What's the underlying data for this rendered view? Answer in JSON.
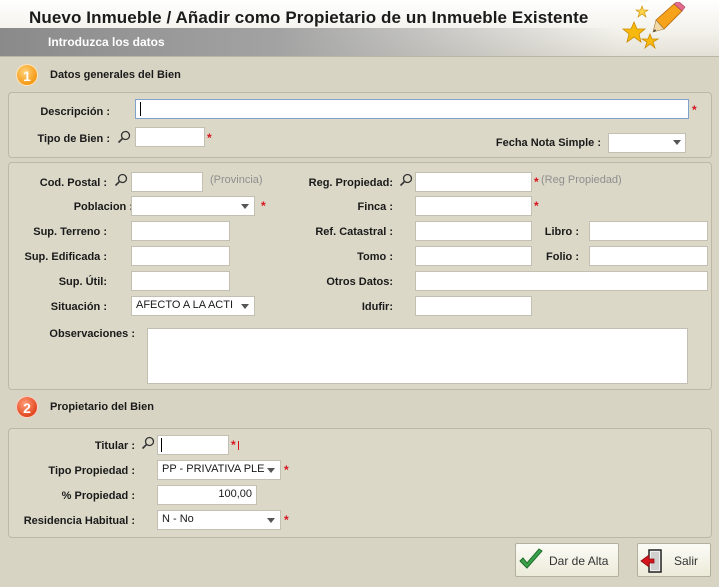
{
  "header": {
    "title": "Nuevo Inmueble / Añadir como Propietario de un Inmueble Existente",
    "subtitle": "Introduzca los datos",
    "icon": "stars-pencil-icon"
  },
  "section1": {
    "number": "1",
    "title": "Datos generales del Bien"
  },
  "section2": {
    "number": "2",
    "title": "Propietario del Bien"
  },
  "general": {
    "descripcion_label": "Descripción :",
    "descripcion_value": "",
    "tipo_bien_label": "Tipo de Bien :",
    "tipo_bien_value": "",
    "fecha_nota_label": "Fecha Nota Simple :",
    "fecha_nota_value": ""
  },
  "location": {
    "cod_postal_label": "Cod. Postal :",
    "cod_postal_value": "",
    "provincia_hint": "(Provincia)",
    "poblacion_label": "Poblacion :",
    "poblacion_value": "",
    "sup_terreno_label": "Sup. Terreno :",
    "sup_edificada_label": "Sup. Edificada :",
    "sup_util_label": "Sup. Útil:",
    "situacion_label": "Situación :",
    "situacion_value": "AFECTO A LA ACTI",
    "observaciones_label": "Observaciones :",
    "reg_propiedad_label": "Reg. Propiedad:",
    "reg_propiedad_hint": "(Reg Propiedad)",
    "finca_label": "Finca :",
    "ref_catastral_label": "Ref. Catastral :",
    "tomo_label": "Tomo :",
    "otros_datos_label": "Otros Datos:",
    "idufir_label": "Idufir:",
    "libro_label": "Libro :",
    "folio_label": "Folio :"
  },
  "owner": {
    "titular_label": "Titular :",
    "titular_value": "",
    "tipo_propiedad_label": "Tipo Propiedad :",
    "tipo_propiedad_value": "PP - PRIVATIVA PLE",
    "pct_propiedad_label": "% Propiedad :",
    "pct_propiedad_value": "100,00",
    "residencia_label": "Residencia Habitual :",
    "residencia_value": "N - No"
  },
  "buttons": {
    "dar_alta": "Dar de Alta",
    "salir": "Salir"
  },
  "required_mark": "*",
  "colors": {
    "required": "#d6141e",
    "section1": "#f59a14",
    "section2": "#e2471f",
    "check": "#3aa14a"
  }
}
